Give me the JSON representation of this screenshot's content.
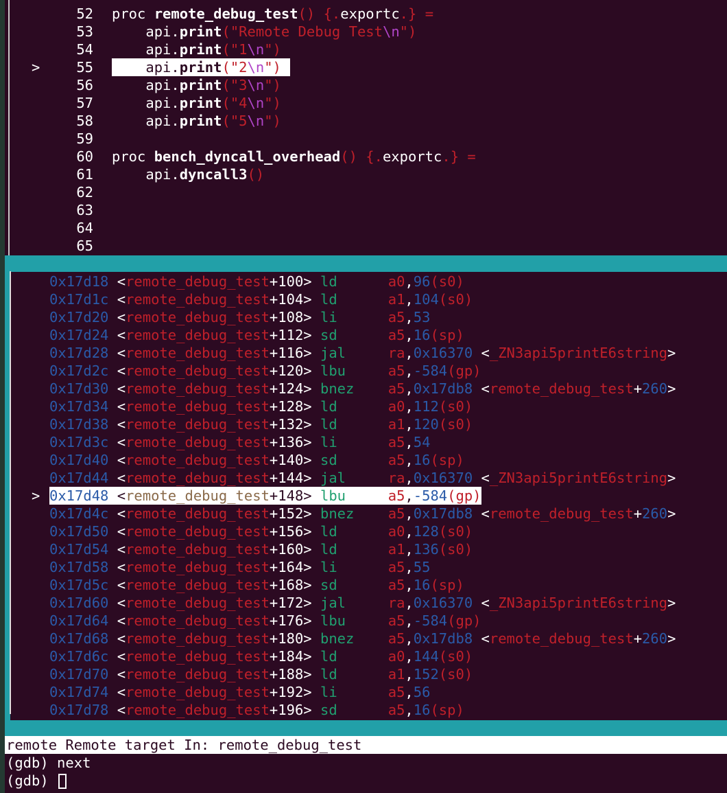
{
  "source": {
    "lines": [
      {
        "num": "52",
        "marker": "",
        "code": [
          [
            "k-kw",
            "proc "
          ],
          [
            "k-fn",
            "remote_debug_test"
          ],
          [
            "k-pun",
            "() {."
          ],
          [
            "k-kw",
            "exportc"
          ],
          [
            "k-pun",
            ".} ="
          ]
        ]
      },
      {
        "num": "53",
        "marker": "",
        "code": [
          [
            "k-kw",
            "    api."
          ],
          [
            "k-fn",
            "print"
          ],
          [
            "k-pun",
            "("
          ],
          [
            "k-str",
            "\"Remote Debug Test"
          ],
          [
            "k-esc",
            "\\n"
          ],
          [
            "k-str",
            "\""
          ],
          [
            "k-pun",
            ")"
          ]
        ]
      },
      {
        "num": "54",
        "marker": "",
        "code": [
          [
            "k-kw",
            "    api."
          ],
          [
            "k-fn",
            "print"
          ],
          [
            "k-pun",
            "("
          ],
          [
            "k-str",
            "\"1"
          ],
          [
            "k-esc",
            "\\n"
          ],
          [
            "k-str",
            "\""
          ],
          [
            "k-pun",
            ")"
          ]
        ]
      },
      {
        "num": "55",
        "marker": ">",
        "highlight": true,
        "code": [
          [
            "k-kw",
            "    api."
          ],
          [
            "k-fn",
            "print"
          ],
          [
            "k-pun",
            "("
          ],
          [
            "k-str",
            "\"2"
          ],
          [
            "k-esc",
            "\\n"
          ],
          [
            "k-str",
            "\""
          ],
          [
            "k-pun",
            ")"
          ]
        ]
      },
      {
        "num": "56",
        "marker": "",
        "code": [
          [
            "k-kw",
            "    api."
          ],
          [
            "k-fn",
            "print"
          ],
          [
            "k-pun",
            "("
          ],
          [
            "k-str",
            "\"3"
          ],
          [
            "k-esc",
            "\\n"
          ],
          [
            "k-str",
            "\""
          ],
          [
            "k-pun",
            ")"
          ]
        ]
      },
      {
        "num": "57",
        "marker": "",
        "code": [
          [
            "k-kw",
            "    api."
          ],
          [
            "k-fn",
            "print"
          ],
          [
            "k-pun",
            "("
          ],
          [
            "k-str",
            "\"4"
          ],
          [
            "k-esc",
            "\\n"
          ],
          [
            "k-str",
            "\""
          ],
          [
            "k-pun",
            ")"
          ]
        ]
      },
      {
        "num": "58",
        "marker": "",
        "code": [
          [
            "k-kw",
            "    api."
          ],
          [
            "k-fn",
            "print"
          ],
          [
            "k-pun",
            "("
          ],
          [
            "k-str",
            "\"5"
          ],
          [
            "k-esc",
            "\\n"
          ],
          [
            "k-str",
            "\""
          ],
          [
            "k-pun",
            ")"
          ]
        ]
      },
      {
        "num": "59",
        "marker": "",
        "code": []
      },
      {
        "num": "60",
        "marker": "",
        "code": [
          [
            "k-kw",
            "proc "
          ],
          [
            "k-fn",
            "bench_dyncall_overhead"
          ],
          [
            "k-pun",
            "() {."
          ],
          [
            "k-kw",
            "exportc"
          ],
          [
            "k-pun",
            ".} ="
          ]
        ]
      },
      {
        "num": "61",
        "marker": "",
        "code": [
          [
            "k-kw",
            "    api."
          ],
          [
            "k-fn",
            "dyncall3"
          ],
          [
            "k-pun",
            "()"
          ]
        ]
      },
      {
        "num": "62",
        "marker": "",
        "code": []
      },
      {
        "num": "63",
        "marker": "",
        "code": []
      },
      {
        "num": "64",
        "marker": "",
        "code": []
      },
      {
        "num": "65",
        "marker": "",
        "code": []
      }
    ]
  },
  "asm": {
    "lines": [
      {
        "marker": "",
        "addr": "0x17d18",
        "off": "+100",
        "ins": "ld",
        "ops": [
          [
            "a-reg",
            "a0"
          ],
          [
            "w",
            ","
          ],
          [
            "a-num",
            "96"
          ],
          [
            "a-reg",
            "(s0)"
          ]
        ]
      },
      {
        "marker": "",
        "addr": "0x17d1c",
        "off": "+104",
        "ins": "ld",
        "ops": [
          [
            "a-reg",
            "a1"
          ],
          [
            "w",
            ","
          ],
          [
            "a-num",
            "104"
          ],
          [
            "a-reg",
            "(s0)"
          ]
        ]
      },
      {
        "marker": "",
        "addr": "0x17d20",
        "off": "+108",
        "ins": "li",
        "ops": [
          [
            "a-reg",
            "a5"
          ],
          [
            "w",
            ","
          ],
          [
            "a-num",
            "53"
          ]
        ]
      },
      {
        "marker": "",
        "addr": "0x17d24",
        "off": "+112",
        "ins": "sd",
        "ops": [
          [
            "a-reg",
            "a5"
          ],
          [
            "w",
            ","
          ],
          [
            "a-num",
            "16"
          ],
          [
            "a-reg",
            "(sp)"
          ]
        ]
      },
      {
        "marker": "",
        "addr": "0x17d28",
        "off": "+116",
        "ins": "jal",
        "ops": [
          [
            "a-reg",
            "ra"
          ],
          [
            "w",
            ","
          ],
          [
            "a-num",
            "0x16370"
          ],
          [
            "w",
            " <"
          ],
          [
            "a-sym",
            "_ZN3api5printE6string"
          ],
          [
            "w",
            ">"
          ]
        ]
      },
      {
        "marker": "",
        "addr": "0x17d2c",
        "off": "+120",
        "ins": "lbu",
        "ops": [
          [
            "a-reg",
            "a5"
          ],
          [
            "w",
            ","
          ],
          [
            "a-num",
            "-584"
          ],
          [
            "a-reg",
            "(gp)"
          ]
        ]
      },
      {
        "marker": "",
        "addr": "0x17d30",
        "off": "+124",
        "ins": "bnez",
        "ops": [
          [
            "a-reg",
            "a5"
          ],
          [
            "w",
            ","
          ],
          [
            "a-num",
            "0x17db8"
          ],
          [
            "w",
            " <"
          ],
          [
            "a-sym",
            "remote_debug_test"
          ],
          [
            "w",
            "+"
          ],
          [
            "a-num",
            "260"
          ],
          [
            "w",
            ">"
          ]
        ]
      },
      {
        "marker": "",
        "addr": "0x17d34",
        "off": "+128",
        "ins": "ld",
        "ops": [
          [
            "a-reg",
            "a0"
          ],
          [
            "w",
            ","
          ],
          [
            "a-num",
            "112"
          ],
          [
            "a-reg",
            "(s0)"
          ]
        ]
      },
      {
        "marker": "",
        "addr": "0x17d38",
        "off": "+132",
        "ins": "ld",
        "ops": [
          [
            "a-reg",
            "a1"
          ],
          [
            "w",
            ","
          ],
          [
            "a-num",
            "120"
          ],
          [
            "a-reg",
            "(s0)"
          ]
        ]
      },
      {
        "marker": "",
        "addr": "0x17d3c",
        "off": "+136",
        "ins": "li",
        "ops": [
          [
            "a-reg",
            "a5"
          ],
          [
            "w",
            ","
          ],
          [
            "a-num",
            "54"
          ]
        ]
      },
      {
        "marker": "",
        "addr": "0x17d40",
        "off": "+140",
        "ins": "sd",
        "ops": [
          [
            "a-reg",
            "a5"
          ],
          [
            "w",
            ","
          ],
          [
            "a-num",
            "16"
          ],
          [
            "a-reg",
            "(sp)"
          ]
        ]
      },
      {
        "marker": "",
        "addr": "0x17d44",
        "off": "+144",
        "ins": "jal",
        "ops": [
          [
            "a-reg",
            "ra"
          ],
          [
            "w",
            ","
          ],
          [
            "a-num",
            "0x16370"
          ],
          [
            "w",
            " <"
          ],
          [
            "a-sym",
            "_ZN3api5printE6string"
          ],
          [
            "w",
            ">"
          ]
        ]
      },
      {
        "marker": ">",
        "highlight": true,
        "addr": "0x17d48",
        "off": "+148",
        "ins": "lbu",
        "ops": [
          [
            "a-reg",
            "a5"
          ],
          [
            "w",
            ","
          ],
          [
            "a-num",
            "-584"
          ],
          [
            "a-reg",
            "(gp)"
          ]
        ]
      },
      {
        "marker": "",
        "addr": "0x17d4c",
        "off": "+152",
        "ins": "bnez",
        "ops": [
          [
            "a-reg",
            "a5"
          ],
          [
            "w",
            ","
          ],
          [
            "a-num",
            "0x17db8"
          ],
          [
            "w",
            " <"
          ],
          [
            "a-sym",
            "remote_debug_test"
          ],
          [
            "w",
            "+"
          ],
          [
            "a-num",
            "260"
          ],
          [
            "w",
            ">"
          ]
        ]
      },
      {
        "marker": "",
        "addr": "0x17d50",
        "off": "+156",
        "ins": "ld",
        "ops": [
          [
            "a-reg",
            "a0"
          ],
          [
            "w",
            ","
          ],
          [
            "a-num",
            "128"
          ],
          [
            "a-reg",
            "(s0)"
          ]
        ]
      },
      {
        "marker": "",
        "addr": "0x17d54",
        "off": "+160",
        "ins": "ld",
        "ops": [
          [
            "a-reg",
            "a1"
          ],
          [
            "w",
            ","
          ],
          [
            "a-num",
            "136"
          ],
          [
            "a-reg",
            "(s0)"
          ]
        ]
      },
      {
        "marker": "",
        "addr": "0x17d58",
        "off": "+164",
        "ins": "li",
        "ops": [
          [
            "a-reg",
            "a5"
          ],
          [
            "w",
            ","
          ],
          [
            "a-num",
            "55"
          ]
        ]
      },
      {
        "marker": "",
        "addr": "0x17d5c",
        "off": "+168",
        "ins": "sd",
        "ops": [
          [
            "a-reg",
            "a5"
          ],
          [
            "w",
            ","
          ],
          [
            "a-num",
            "16"
          ],
          [
            "a-reg",
            "(sp)"
          ]
        ]
      },
      {
        "marker": "",
        "addr": "0x17d60",
        "off": "+172",
        "ins": "jal",
        "ops": [
          [
            "a-reg",
            "ra"
          ],
          [
            "w",
            ","
          ],
          [
            "a-num",
            "0x16370"
          ],
          [
            "w",
            " <"
          ],
          [
            "a-sym",
            "_ZN3api5printE6string"
          ],
          [
            "w",
            ">"
          ]
        ]
      },
      {
        "marker": "",
        "addr": "0x17d64",
        "off": "+176",
        "ins": "lbu",
        "ops": [
          [
            "a-reg",
            "a5"
          ],
          [
            "w",
            ","
          ],
          [
            "a-num",
            "-584"
          ],
          [
            "a-reg",
            "(gp)"
          ]
        ]
      },
      {
        "marker": "",
        "addr": "0x17d68",
        "off": "+180",
        "ins": "bnez",
        "ops": [
          [
            "a-reg",
            "a5"
          ],
          [
            "w",
            ","
          ],
          [
            "a-num",
            "0x17db8"
          ],
          [
            "w",
            " <"
          ],
          [
            "a-sym",
            "remote_debug_test"
          ],
          [
            "w",
            "+"
          ],
          [
            "a-num",
            "260"
          ],
          [
            "w",
            ">"
          ]
        ]
      },
      {
        "marker": "",
        "addr": "0x17d6c",
        "off": "+184",
        "ins": "ld",
        "ops": [
          [
            "a-reg",
            "a0"
          ],
          [
            "w",
            ","
          ],
          [
            "a-num",
            "144"
          ],
          [
            "a-reg",
            "(s0)"
          ]
        ]
      },
      {
        "marker": "",
        "addr": "0x17d70",
        "off": "+188",
        "ins": "ld",
        "ops": [
          [
            "a-reg",
            "a1"
          ],
          [
            "w",
            ","
          ],
          [
            "a-num",
            "152"
          ],
          [
            "a-reg",
            "(s0)"
          ]
        ]
      },
      {
        "marker": "",
        "addr": "0x17d74",
        "off": "+192",
        "ins": "li",
        "ops": [
          [
            "a-reg",
            "a5"
          ],
          [
            "w",
            ","
          ],
          [
            "a-num",
            "56"
          ]
        ]
      },
      {
        "marker": "",
        "addr": "0x17d78",
        "off": "+196",
        "ins": "sd",
        "ops": [
          [
            "a-reg",
            "a5"
          ],
          [
            "w",
            ","
          ],
          [
            "a-num",
            "16"
          ],
          [
            "a-reg",
            "(sp)"
          ]
        ]
      }
    ],
    "func_name": "remote_debug_test"
  },
  "status_bar": {
    "text": "remote Remote target In: remote_debug_test"
  },
  "console": {
    "line1": "(gdb) next",
    "prompt": "(gdb) "
  }
}
